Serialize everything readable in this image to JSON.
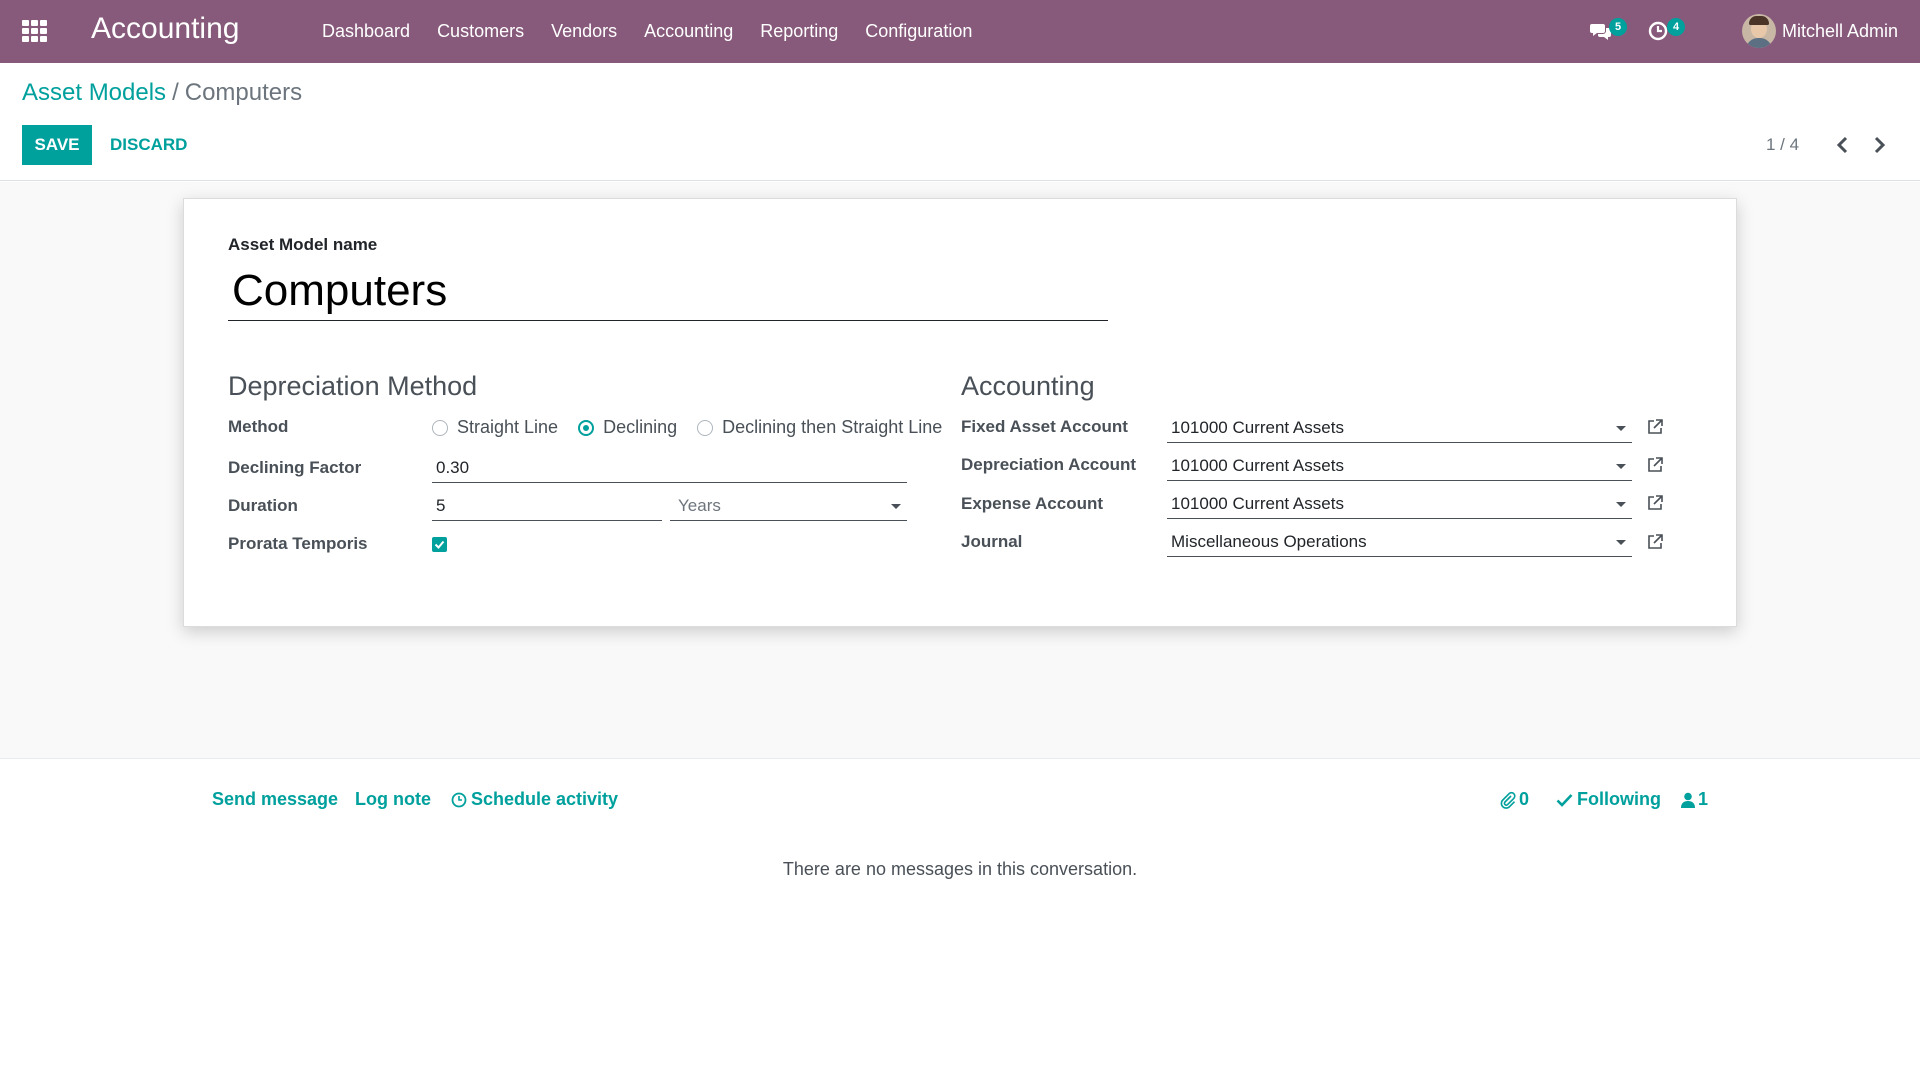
{
  "navbar": {
    "app_title": "Accounting",
    "menu": [
      "Dashboard",
      "Customers",
      "Vendors",
      "Accounting",
      "Reporting",
      "Configuration"
    ],
    "messages_badge": "5",
    "activities_badge": "4",
    "user_name": "Mitchell Admin"
  },
  "control_panel": {
    "breadcrumb_parent": "Asset Models",
    "breadcrumb_separator": "/",
    "breadcrumb_current": "Computers",
    "save_label": "SAVE",
    "discard_label": "DISCARD",
    "pager": "1 / 4"
  },
  "form": {
    "name_label": "Asset Model name",
    "name_value": "Computers",
    "depreciation": {
      "title": "Depreciation Method",
      "method_label": "Method",
      "method_options": [
        "Straight Line",
        "Declining",
        "Declining then Straight Line"
      ],
      "method_selected": "Declining",
      "declining_factor_label": "Declining Factor",
      "declining_factor_value": "0.30",
      "duration_label": "Duration",
      "duration_value": "5",
      "duration_unit": "Years",
      "prorata_label": "Prorata Temporis",
      "prorata_checked": true
    },
    "accounting": {
      "title": "Accounting",
      "fixed_asset_label": "Fixed Asset Account",
      "fixed_asset_value": "101000 Current Assets",
      "depreciation_account_label": "Depreciation Account",
      "depreciation_account_value": "101000 Current Assets",
      "expense_account_label": "Expense Account",
      "expense_account_value": "101000 Current Assets",
      "journal_label": "Journal",
      "journal_value": "Miscellaneous Operations"
    }
  },
  "chatter": {
    "send_message": "Send message",
    "log_note": "Log note",
    "schedule_activity": "Schedule activity",
    "attachments_count": "0",
    "following": "Following",
    "followers_count": "1",
    "empty_text": "There are no messages in this conversation."
  },
  "colors": {
    "navbar": "#875a7b",
    "accent": "#00a09d"
  }
}
